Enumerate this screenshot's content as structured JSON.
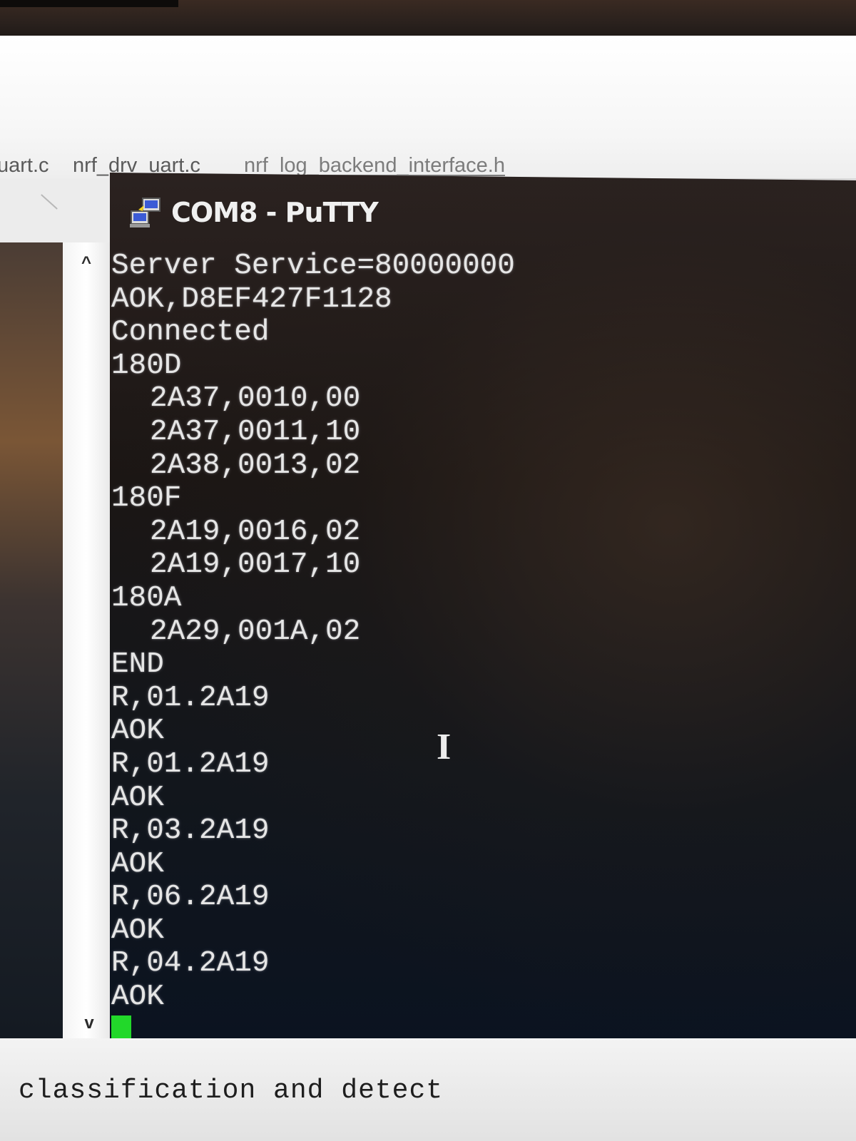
{
  "editor": {
    "tabs": [
      "uart.c",
      "nrf_drv_uart.c",
      "nrf_log_backend_interface.h"
    ]
  },
  "putty": {
    "title": "COM8 - PuTTY",
    "icon": "putty-icon",
    "cursor_color": "#22d82a",
    "lines": [
      {
        "text": "Server Service=80000000",
        "indent": false
      },
      {
        "text": "AOK,D8EF427F1128",
        "indent": false
      },
      {
        "text": "Connected",
        "indent": false
      },
      {
        "text": "180D",
        "indent": false
      },
      {
        "text": "2A37,0010,00",
        "indent": true
      },
      {
        "text": "2A37,0011,10",
        "indent": true
      },
      {
        "text": "2A38,0013,02",
        "indent": true
      },
      {
        "text": "180F",
        "indent": false
      },
      {
        "text": "2A19,0016,02",
        "indent": true
      },
      {
        "text": "2A19,0017,10",
        "indent": true
      },
      {
        "text": "180A",
        "indent": false
      },
      {
        "text": "2A29,001A,02",
        "indent": true
      },
      {
        "text": "END",
        "indent": false
      },
      {
        "text": "R,01.2A19",
        "indent": false
      },
      {
        "text": "AOK",
        "indent": false
      },
      {
        "text": "R,01.2A19",
        "indent": false
      },
      {
        "text": "AOK",
        "indent": false
      },
      {
        "text": "R,03.2A19",
        "indent": false
      },
      {
        "text": "AOK",
        "indent": false
      },
      {
        "text": "R,06.2A19",
        "indent": false
      },
      {
        "text": "AOK",
        "indent": false
      },
      {
        "text": "R,04.2A19",
        "indent": false
      },
      {
        "text": "AOK",
        "indent": false
      }
    ]
  },
  "scrollbar": {
    "up_icon": "^",
    "down_icon": "v"
  },
  "background_editor": {
    "visible_text": "classification and detect"
  }
}
